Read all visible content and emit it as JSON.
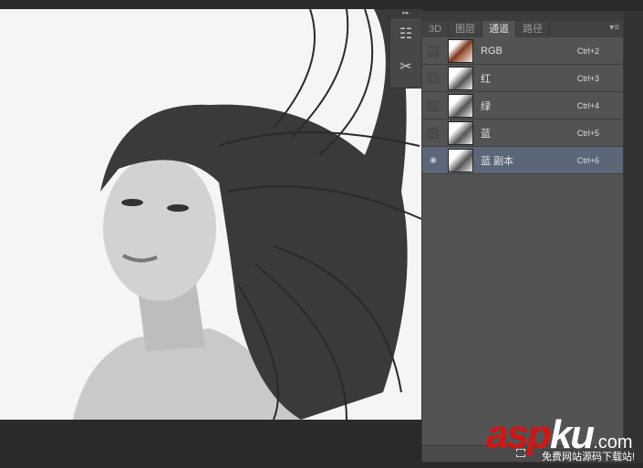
{
  "tool_strip": {
    "collapse_glyph": "▸▸",
    "tools": [
      {
        "icon": "channel-mixer-icon",
        "glyph": "☷"
      },
      {
        "icon": "tools-icon",
        "glyph": "✂"
      }
    ]
  },
  "panel": {
    "tabs": [
      {
        "label": "3D"
      },
      {
        "label": "图层"
      },
      {
        "label": "通道",
        "active": true
      },
      {
        "label": "路径"
      }
    ],
    "menu_glyph": "▾≡",
    "channels": [
      {
        "name": "RGB",
        "shortcut": "Ctrl+2",
        "visible": false
      },
      {
        "name": "红",
        "shortcut": "Ctrl+3",
        "visible": false
      },
      {
        "name": "绿",
        "shortcut": "Ctrl+4",
        "visible": false
      },
      {
        "name": "蓝",
        "shortcut": "Ctrl+5",
        "visible": false
      },
      {
        "name": "蓝 副本",
        "shortcut": "Ctrl+6",
        "visible": true,
        "selected": true
      }
    ],
    "eye_glyph": "◉"
  },
  "watermark": {
    "brand_a": "asp",
    "brand_b": "ku",
    "domain": ".com",
    "tagline": "免费网站源码下载站!"
  },
  "colors": {
    "selected_row": "#5b6779",
    "panel_bg": "#535353",
    "brand_red": "#d31515"
  }
}
